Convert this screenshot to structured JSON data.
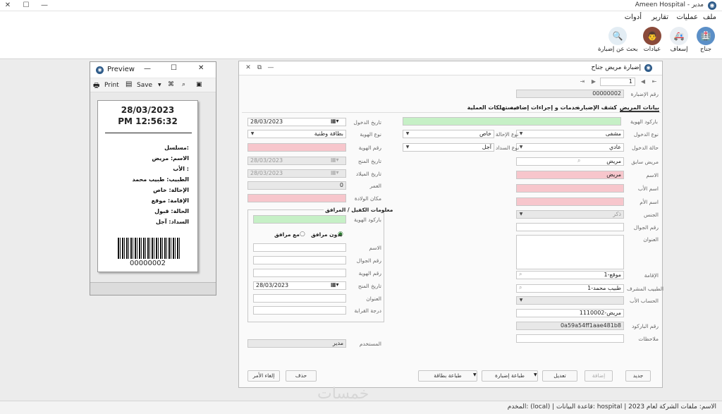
{
  "window": {
    "title": "Ameen Hospital - مدير",
    "minimize": "—",
    "maximize": "☐",
    "close": "✕"
  },
  "menu": [
    "ملف",
    "عمليات",
    "تقارير",
    "أدوات"
  ],
  "ribbon": [
    {
      "label": "جناح",
      "icon": "hospital-icon",
      "color": "#5b8fc7"
    },
    {
      "label": "إسعاف",
      "icon": "ambulance-icon",
      "color": "#d9534f"
    },
    {
      "label": "عيادات",
      "icon": "doctor-icon",
      "color": "#8a4a3a"
    },
    {
      "label": "بحث عن إضبارة",
      "icon": "search-file-icon",
      "color": "#7aa6c2"
    }
  ],
  "patient_window": {
    "title": "إضبارة مريض جناح",
    "nav_page": "1",
    "file_number_label": "رقم الإضبارة",
    "file_number": "00000002",
    "tabs": [
      "بيانات المريض",
      "كشف الإضبارة",
      "خدمات و إجراءات إضافية",
      "مستهلكات العملية"
    ],
    "right": {
      "id_barcode_label": "باركود الهوية",
      "admission_type_label": "نوع الدخول",
      "admission_type": "مشفى",
      "referral_type_label": "نوع الإحالة",
      "referral_type": "خاص",
      "admission_status_label": "حالة الدخول",
      "admission_status": "عادي",
      "payment_type_label": "نوع السداد",
      "payment_type": "آجل",
      "previous_patient_label": "مريض سابق",
      "previous_patient": "مريض",
      "name_label": "الاسم",
      "name": "مريض",
      "father_label": "اسم الأب",
      "mother_label": "اسم الأم",
      "gender_label": "الجنس",
      "gender": "ذكر",
      "mobile_label": "رقم الجوال",
      "address_label": "العنوان",
      "residence_label": "الإقامة",
      "residence": "1-موقع",
      "supervisor_label": "الطبيب المشرف",
      "supervisor": "1-طبيب محمد",
      "father_account_label": "الحساب الأب",
      "account": "1110002-مريض",
      "barcode_number_label": "رقم الباركود",
      "barcode_number": "0a59a54ff1aae481b8",
      "notes_label": "ملاحظات"
    },
    "left": {
      "entry_date_label": "تاريخ الدخول",
      "entry_date": "28/03/2023",
      "id_type_label": "نوع الهوية",
      "id_type": "بطاقة وطنية",
      "id_number_label": "رقم الهوية",
      "issue_date_label": "تاريخ المنح",
      "issue_date": "28/03/2023",
      "birth_date_label": "تاريخ الميلاد",
      "birth_date": "28/03/2023",
      "age_label": "العمر",
      "age": "0",
      "birthplace_label": "مكان الولادة",
      "guarantor_title": "معلومات الكفيل / المرافق",
      "g_barcode_label": "باركود الهوية",
      "radio_without": "بدون مرافق",
      "radio_with": "مع مرافق",
      "g_name_label": "الاسم",
      "g_mobile_label": "رقم الجوال",
      "g_id_label": "رقم الهوية",
      "g_issue_label": "تاريخ المنح",
      "g_issue": "28/03/2023",
      "g_address_label": "العنوان",
      "g_relation_label": "درجة القرابة",
      "user_label": "المستخدم",
      "user": "مدير"
    },
    "buttons": {
      "new": "جديد",
      "add": "إضافة",
      "edit": "تعديل",
      "print_file": "طباعة إضبارة",
      "print_card": "طباعة بطاقة",
      "delete": "حذف",
      "cancel": "إلغاء الأمر"
    }
  },
  "preview": {
    "title": "Preview",
    "print": "Print",
    "save": "Save",
    "date": "28/03/2023",
    "time": "PM 12:56:32",
    "lines": [
      "مسلسل:",
      "الاسم: مريض",
      "الأب :",
      "الطبيب: طبيب محمد",
      "الإحالة: خاص",
      "الإقامة: موقع",
      "الحالة: قبول",
      "السداد: آجل"
    ],
    "barcode_number": "00000002"
  },
  "status": "المخدم: (local) | قاعدة البيانات: hospital | الاسم: ملفات الشركة لعام 2023",
  "watermark": "خمسات"
}
